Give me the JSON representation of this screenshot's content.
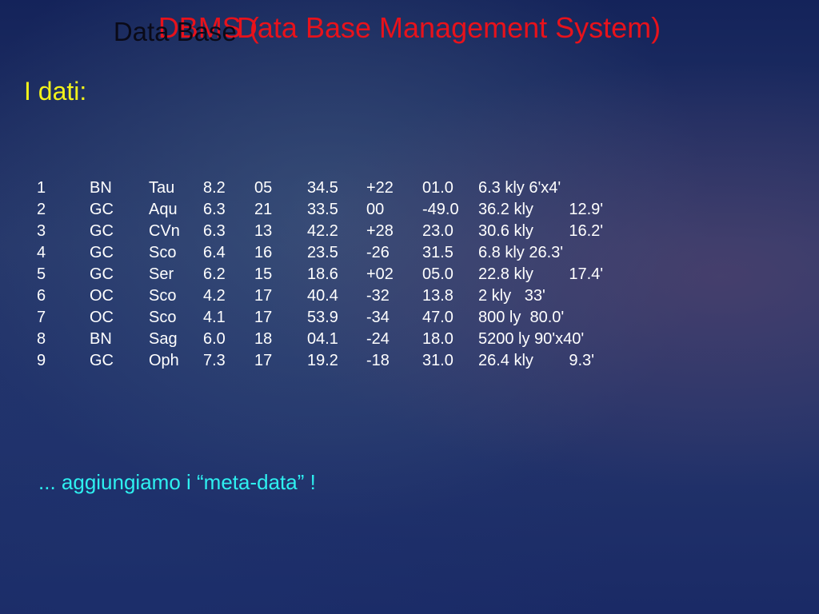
{
  "slide": {
    "title": {
      "prefix": "DBMS (",
      "overlay": "Data Base",
      "underlying": "Data Base",
      "suffix": " Management System)"
    },
    "subtitle": "I dati:",
    "rows": [
      [
        "1",
        "BN",
        "Tau",
        "8.2",
        "05",
        "34.5",
        "+22",
        "01.0",
        "6.3 kly 6'x4'"
      ],
      [
        "2",
        "GC",
        "Aqu",
        "6.3",
        "21",
        "33.5",
        "00",
        "-49.0",
        "36.2 kly        12.9'"
      ],
      [
        "3",
        "GC",
        "CVn",
        "6.3",
        "13",
        "42.2",
        "+28",
        "23.0",
        "30.6 kly        16.2'"
      ],
      [
        "4",
        "GC",
        "Sco",
        "6.4",
        "16",
        "23.5",
        "-26",
        "31.5",
        "6.8 kly 26.3'"
      ],
      [
        "5",
        "GC",
        "Ser",
        "6.2",
        "15",
        "18.6",
        "+02",
        "05.0",
        "22.8 kly        17.4'"
      ],
      [
        "6",
        "OC",
        "Sco",
        "4.2",
        "17",
        "40.4",
        "-32",
        "13.8",
        "2 kly   33'"
      ],
      [
        "7",
        "OC",
        "Sco",
        "4.1",
        "17",
        "53.9",
        "-34",
        "47.0",
        "800 ly  80.0'"
      ],
      [
        "8",
        "BN",
        "Sag",
        "6.0",
        "18",
        "04.1",
        "-24",
        "18.0",
        "5200 ly 90'x40'"
      ],
      [
        "9",
        "GC",
        "Oph",
        "7.3",
        "17",
        "19.2",
        "-18",
        "31.0",
        "26.4 kly        9.3'"
      ]
    ],
    "footer": "... aggiungiamo i “meta-data” !"
  }
}
